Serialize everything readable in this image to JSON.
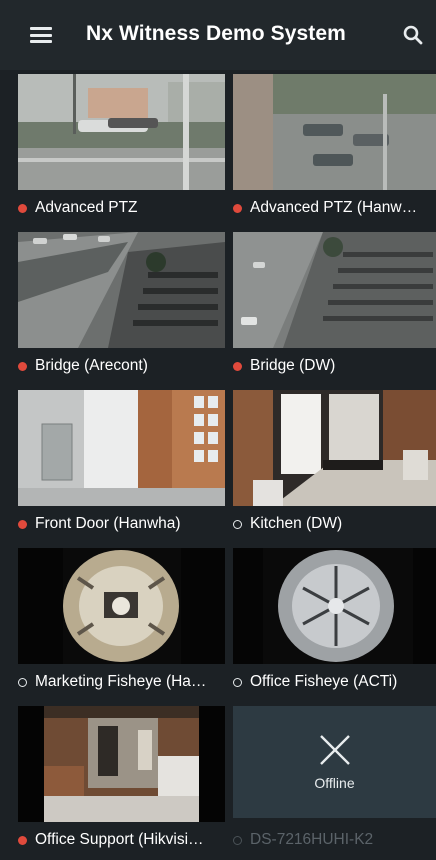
{
  "header": {
    "title": "Nx Witness Demo System",
    "menu_icon": "hamburger-menu-icon",
    "search_icon": "search-icon"
  },
  "colors": {
    "background": "#1c2125",
    "header": "#22282c",
    "recording_dot": "#e04a3c",
    "offline_tile": "#2d3a42"
  },
  "cameras": [
    {
      "name": "Advanced PTZ",
      "status": "recording"
    },
    {
      "name": "Advanced PTZ (Hanw…",
      "status": "recording"
    },
    {
      "name": "Bridge (Arecont)",
      "status": "recording"
    },
    {
      "name": "Bridge (DW)",
      "status": "recording"
    },
    {
      "name": "Front Door (Hanwha)",
      "status": "recording"
    },
    {
      "name": "Kitchen (DW)",
      "status": "online"
    },
    {
      "name": "Marketing Fisheye (Ha…",
      "status": "online"
    },
    {
      "name": "Office Fisheye (ACTi)",
      "status": "online"
    },
    {
      "name": "Office Support (Hikvisi…",
      "status": "recording"
    },
    {
      "name": "DS-7216HUHI-K2",
      "status": "offline",
      "overlay_text": "Offline"
    }
  ]
}
